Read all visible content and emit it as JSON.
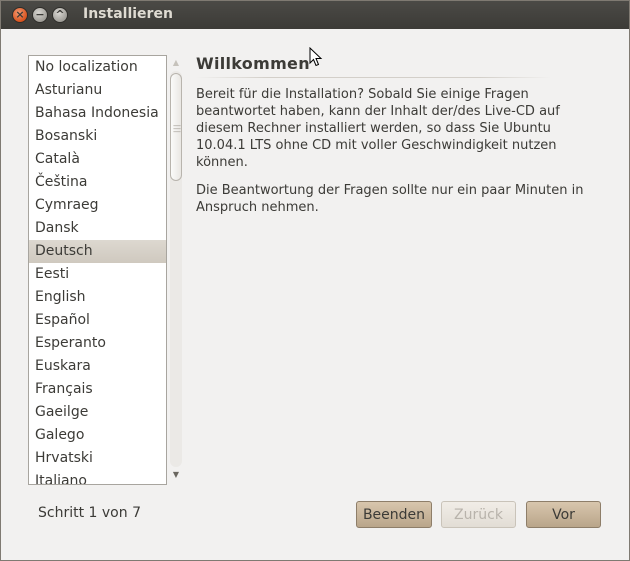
{
  "window": {
    "title": "Installieren",
    "close_glyph": "×",
    "minimize_glyph": "−",
    "maximize_glyph": "^"
  },
  "languages": {
    "selected": "Deutsch",
    "items": [
      "No localization",
      "Asturianu",
      "Bahasa Indonesia",
      "Bosanski",
      "Català",
      "Čeština",
      "Cymraeg",
      "Dansk",
      "Deutsch",
      "Eesti",
      "English",
      "Español",
      "Esperanto",
      "Euskara",
      "Français",
      "Gaeilge",
      "Galego",
      "Hrvatski",
      "Italiano"
    ]
  },
  "welcome": {
    "heading": "Willkommen",
    "paragraph1": "Bereit für die Installation? Sobald Sie einige Fragen beantwortet haben, kann der Inhalt der/des Live-CD auf diesem Rechner installiert werden, so dass Sie Ubuntu 10.04.1 LTS ohne CD mit voller Geschwindigkeit nutzen können.",
    "paragraph2": "Die Beantwortung der Fragen sollte nur ein paar Minuten in Anspruch nehmen."
  },
  "footer": {
    "step": "Schritt 1 von 7",
    "quit_label": "Beenden",
    "back_label": "Zurück",
    "next_label": "Vor"
  },
  "icons": {
    "close": "close-icon",
    "minimize": "minimize-icon",
    "maximize": "maximize-icon",
    "scroll_up": "chevron-up-icon",
    "scroll_down": "chevron-down-icon",
    "cursor": "mouse-pointer-icon"
  },
  "colors": {
    "titlebar": "#3c3b37",
    "close_button": "#d9531e",
    "selection": "#cfc9bf",
    "button_accent": "#c8b598"
  }
}
